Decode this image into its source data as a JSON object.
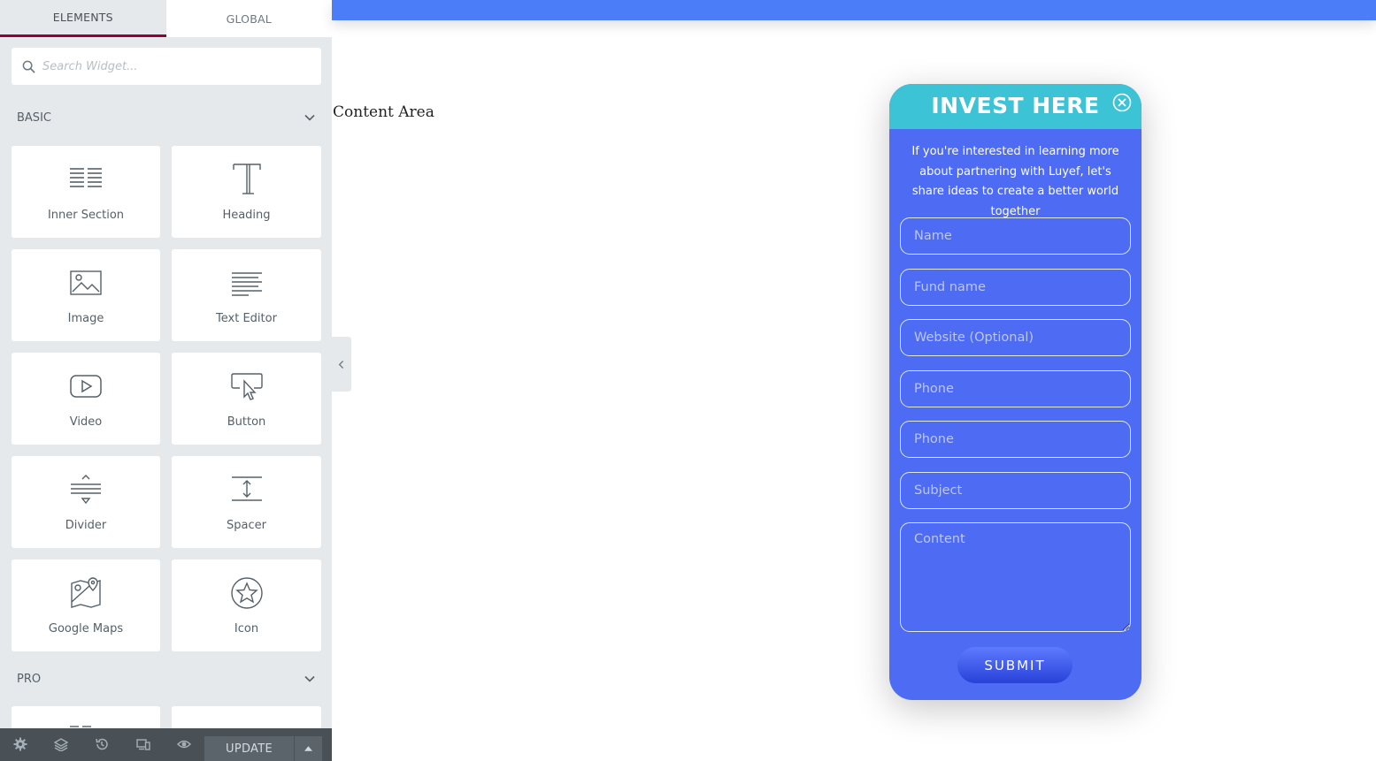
{
  "sidebar": {
    "tabs": [
      {
        "label": "ELEMENTS",
        "active": true
      },
      {
        "label": "GLOBAL",
        "active": false
      }
    ],
    "search": {
      "placeholder": "Search Widget..."
    },
    "categories": {
      "basic": {
        "title": "BASIC"
      },
      "pro": {
        "title": "PRO"
      }
    },
    "widgets": [
      {
        "label": "Inner Section",
        "icon": "inner-section-icon"
      },
      {
        "label": "Heading",
        "icon": "heading-icon"
      },
      {
        "label": "Image",
        "icon": "image-icon"
      },
      {
        "label": "Text Editor",
        "icon": "text-editor-icon"
      },
      {
        "label": "Video",
        "icon": "video-icon"
      },
      {
        "label": "Button",
        "icon": "button-icon"
      },
      {
        "label": "Divider",
        "icon": "divider-icon"
      },
      {
        "label": "Spacer",
        "icon": "spacer-icon"
      },
      {
        "label": "Google Maps",
        "icon": "google-maps-icon"
      },
      {
        "label": "Icon",
        "icon": "star-icon"
      }
    ],
    "footer": {
      "update_label": "UPDATE"
    }
  },
  "canvas": {
    "content_area": "Content Area"
  },
  "popup": {
    "title": "INVEST HERE",
    "description": "If you're interested in learning more about partnering with Luyef, let's share ideas to create a better world together",
    "fields": {
      "name": "Name",
      "fund_name": "Fund name",
      "website": "Website (Optional)",
      "phone_1": "Phone",
      "phone_2": "Phone",
      "subject": "Subject",
      "content": "Content"
    },
    "submit_label": "SUBMIT"
  },
  "colors": {
    "panel_bg": "#e6e9ec",
    "tab_accent": "#93003c",
    "top_band": "#4b7df9",
    "popup_bg": "#4d6bf3",
    "popup_header": "#3cc3d5",
    "bottom_bar": "#495157"
  }
}
